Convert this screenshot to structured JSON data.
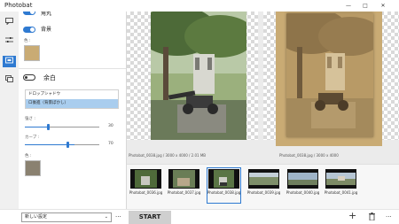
{
  "window": {
    "title": "Photobat",
    "minimize": "—",
    "maximize": "□",
    "close": "✕"
  },
  "rail": {
    "items": [
      {
        "icon": "speech-bubble-icon",
        "glyph": "▭"
      },
      {
        "icon": "sliders-icon",
        "glyph": "≡"
      },
      {
        "icon": "frame-icon",
        "glyph": "▭"
      },
      {
        "icon": "layers-icon",
        "glyph": "❐"
      }
    ],
    "expand": "›"
  },
  "panel": {
    "top_cut_label": "角丸",
    "background": {
      "label": "背景",
      "color_label": "色 :",
      "color": "#c9ab74",
      "enabled": true
    },
    "margin": {
      "label": "余白",
      "enabled": false
    },
    "dropdown": {
      "items": [
        "ドロップシャドウ",
        "ロ後進（背景ぼかし）"
      ],
      "selected_index": 1
    },
    "blur": {
      "label": "強さ :",
      "value": "30",
      "fraction": 0.3
    },
    "curve": {
      "label": "カーブ :",
      "value": "70",
      "fraction": 0.7
    },
    "shadow_color": {
      "label": "色 :",
      "color": "#8a8170"
    }
  },
  "preview": {
    "left_caption": "Photobat_0038.jpg / 3000 x 4000 / 2.01 MB",
    "right_caption": "Photobat_0038.jpg / 3000 x 4000"
  },
  "filmstrip": {
    "selected_index": 2,
    "items": [
      {
        "name": "Photobat_0036.jpg"
      },
      {
        "name": "Photobat_0037.jpg"
      },
      {
        "name": "Photobat_0038.jpg"
      },
      {
        "name": "Photobat_0039.jpg"
      },
      {
        "name": "Photobat_0040.jpg"
      },
      {
        "name": "Photobat_0041.jpg"
      }
    ]
  },
  "bottombar": {
    "preset": "新しい設定",
    "preset_arrow": "⌄",
    "more": "···",
    "start": "START",
    "add": "+",
    "delete": "🗑",
    "overflow": "···"
  },
  "colors": {
    "accent": "#2f7ad1",
    "selection": "#a9cdee",
    "sepia": "#c9ab74"
  }
}
